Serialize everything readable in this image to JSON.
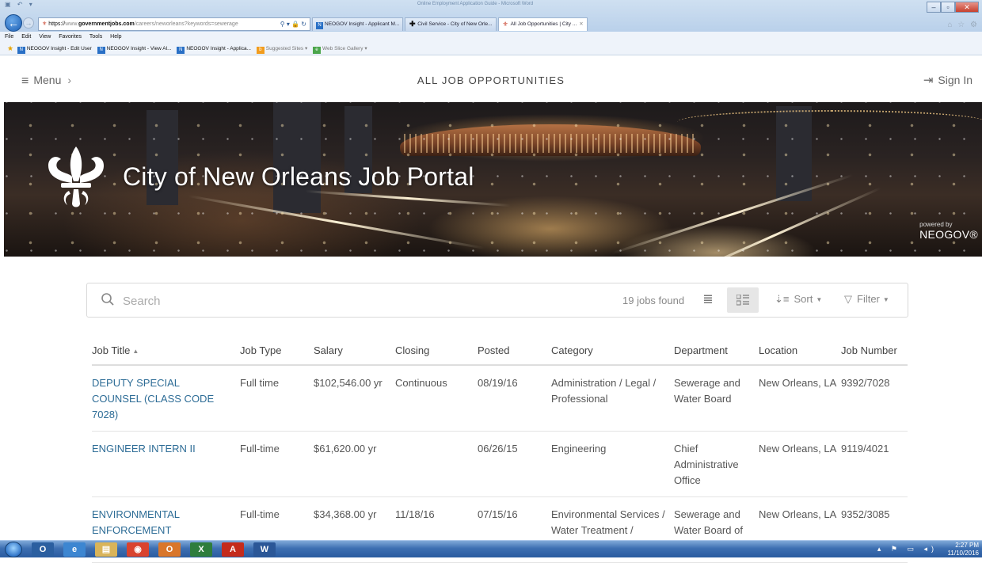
{
  "browser": {
    "window_title": "Online Employment Application Guide - Microsoft Word",
    "address": {
      "scheme": "https://",
      "host_prefix": "www.",
      "host": "governmentjobs.com",
      "path": "/careers/neworleans?keywords=sewerage"
    },
    "tabs": [
      {
        "label": "NEOGOV Insight - Applicant M...",
        "icon": "neogov-icon"
      },
      {
        "label": "Civil Service - City of New Orle...",
        "icon": "plus-icon"
      },
      {
        "label": "All Job Opportunities | City ...",
        "icon": "fleur-icon",
        "active": true
      }
    ],
    "menu": [
      "File",
      "Edit",
      "View",
      "Favorites",
      "Tools",
      "Help"
    ],
    "favorites": [
      "NEOGOV Insight - Edit User",
      "NEOGOV Insight - View Al...",
      "NEOGOV Insight - Applica...",
      "Suggested Sites ▾",
      "Web Slice Gallery ▾"
    ]
  },
  "header": {
    "menu_label": "Menu",
    "title": "ALL JOB OPPORTUNITIES",
    "signin_label": "Sign In"
  },
  "banner": {
    "title": "City of New Orleans Job Portal",
    "powered_by": "powered by",
    "brand": "NEOGOV®"
  },
  "search": {
    "placeholder": "Search",
    "value": "",
    "jobs_found": "19 jobs found",
    "sort_label": "Sort",
    "filter_label": "Filter"
  },
  "table": {
    "columns": [
      "Job Title",
      "Job Type",
      "Salary",
      "Closing",
      "Posted",
      "Category",
      "Department",
      "Location",
      "Job Number"
    ],
    "rows": [
      {
        "title": "DEPUTY SPECIAL COUNSEL (CLASS CODE 7028)",
        "type": "Full time",
        "salary": "$102,546.00 yr",
        "closing": "Continuous",
        "posted": "08/19/16",
        "category": "Administration / Legal / Professional",
        "department": "Sewerage and Water Board",
        "location": "New Orleans, LA",
        "number": "9392/7028"
      },
      {
        "title": "ENGINEER INTERN II",
        "type": "Full-time",
        "salary": "$61,620.00 yr",
        "closing": "",
        "posted": "06/26/15",
        "category": "Engineering",
        "department": "Chief Administrative Office",
        "location": "New Orleans, LA",
        "number": "9119/4021"
      },
      {
        "title": "ENVIRONMENTAL ENFORCEMENT TECHNICIAN I (CLASS",
        "type": "Full-time",
        "salary": "$34,368.00 yr",
        "closing": "11/18/16",
        "posted": "07/15/16",
        "category": "Environmental Services / Water Treatment /",
        "department": "Sewerage and Water Board of New",
        "location": "New Orleans, LA",
        "number": "9352/3085"
      }
    ]
  },
  "taskbar": {
    "time": "2:27 PM",
    "date": "11/10/2016"
  },
  "colors": {
    "link": "#2d6c96",
    "accent": "#2970c6",
    "border": "#d9d9d9"
  }
}
